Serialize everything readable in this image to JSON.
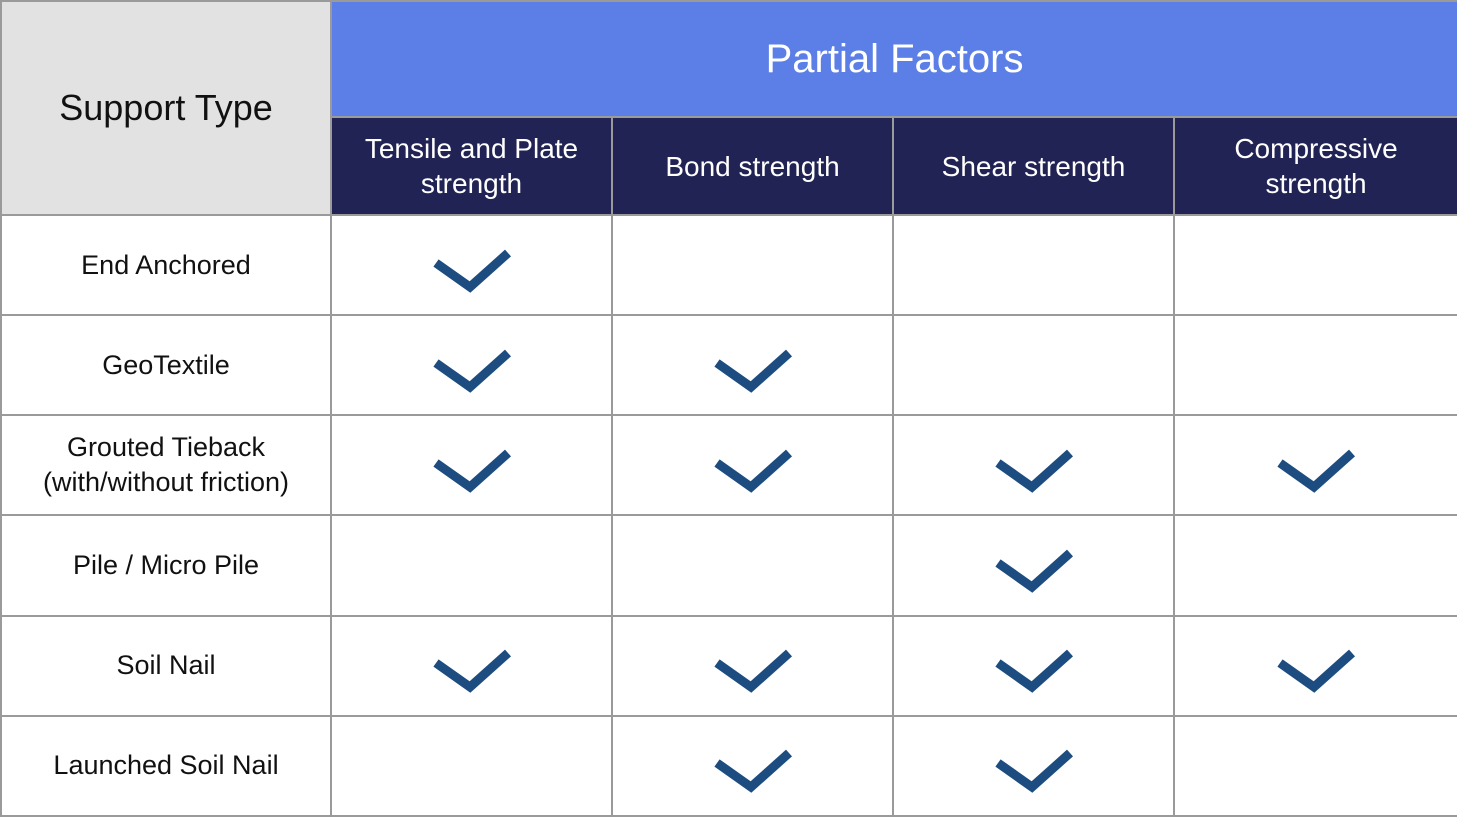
{
  "table": {
    "support_header": "Support Type",
    "group_header": "Partial Factors",
    "columns": [
      {
        "line1": "Tensile and Plate",
        "line2": "strength"
      },
      {
        "line1": "Bond strength",
        "line2": ""
      },
      {
        "line1": "Shear strength",
        "line2": ""
      },
      {
        "line1": "Compressive",
        "line2": "strength"
      }
    ],
    "rows": [
      {
        "label1": "End Anchored",
        "label2": "",
        "checks": [
          true,
          false,
          false,
          false
        ]
      },
      {
        "label1": "GeoTextile",
        "label2": "",
        "checks": [
          true,
          true,
          false,
          false
        ]
      },
      {
        "label1": "Grouted Tieback",
        "label2": "(with/without friction)",
        "checks": [
          true,
          true,
          true,
          true
        ]
      },
      {
        "label1": "Pile / Micro Pile",
        "label2": "",
        "checks": [
          false,
          false,
          true,
          false
        ]
      },
      {
        "label1": "Soil Nail",
        "label2": "",
        "checks": [
          true,
          true,
          true,
          true
        ]
      },
      {
        "label1": "Launched Soil Nail",
        "label2": "",
        "checks": [
          false,
          true,
          true,
          false
        ]
      }
    ]
  },
  "colors": {
    "group_header_bg": "#5b7fe6",
    "sub_header_bg": "#222355",
    "support_header_bg": "#e2e2e2",
    "check_color": "#1d4c80",
    "grid_color": "#9a9a9a"
  },
  "icons": {
    "check": "checkmark-icon"
  }
}
